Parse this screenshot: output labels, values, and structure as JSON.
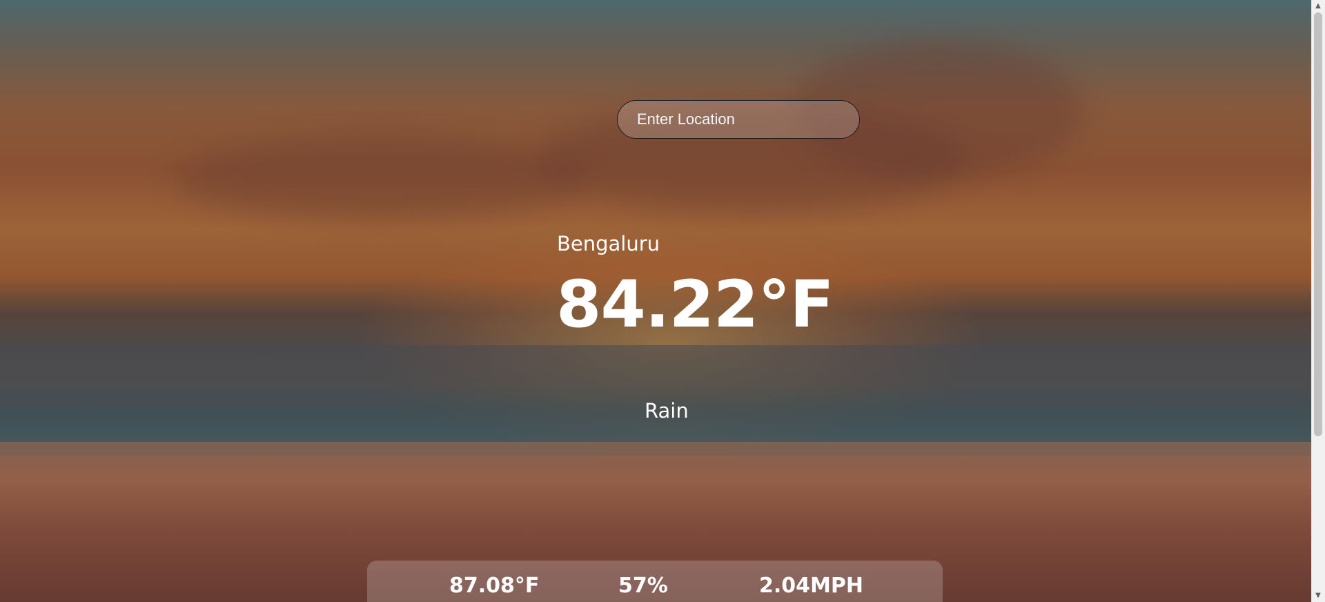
{
  "search": {
    "placeholder": "Enter Location",
    "value": ""
  },
  "current": {
    "city": "Bengaluru",
    "temperature": "84.22°F",
    "condition": "Rain"
  },
  "stats": {
    "feels_like": "87.08°F",
    "humidity": "57%",
    "wind_speed": "2.04MPH"
  },
  "colors": {
    "text": "#ffffff",
    "search_border": "#1c1c1c",
    "scrollbar_track": "#f1f1f1",
    "scrollbar_thumb": "#c1c1c1"
  },
  "icons": {
    "scroll_up": "scroll-up-arrow-icon",
    "scroll_down": "scroll-down-arrow-icon"
  }
}
